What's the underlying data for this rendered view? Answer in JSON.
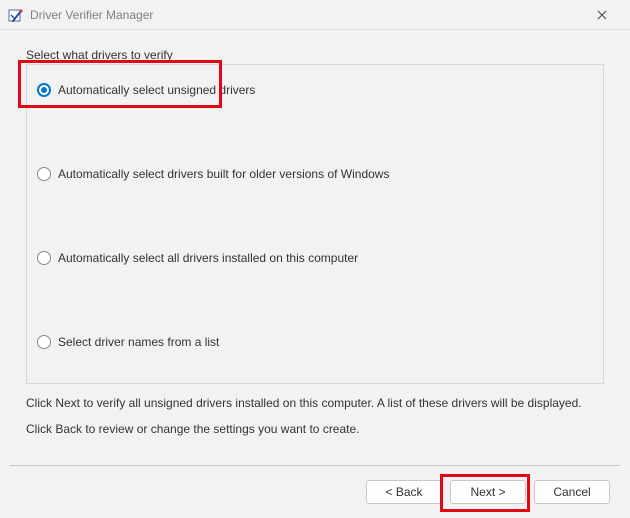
{
  "titlebar": {
    "title": "Driver Verifier Manager"
  },
  "section": {
    "label": "Select what drivers to verify"
  },
  "options": [
    {
      "label": "Automatically select unsigned drivers",
      "selected": true
    },
    {
      "label": "Automatically select drivers built for older versions of Windows",
      "selected": false
    },
    {
      "label": "Automatically select all drivers installed on this computer",
      "selected": false
    },
    {
      "label": "Select driver names from a list",
      "selected": false
    }
  ],
  "instructions": {
    "line1": "Click Next to verify all unsigned drivers installed on this computer. A list of these drivers will be displayed.",
    "line2": "Click Back to review or change the settings you want to create."
  },
  "buttons": {
    "back": "< Back",
    "next": "Next >",
    "cancel": "Cancel"
  }
}
